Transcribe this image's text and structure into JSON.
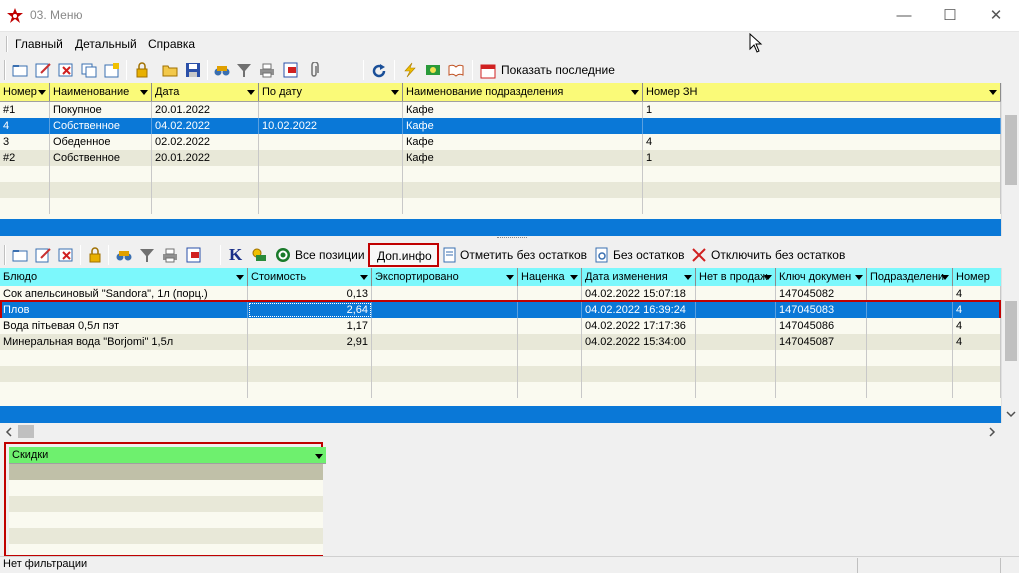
{
  "window": {
    "title": "03. Меню",
    "minimize_glyph": "—",
    "maximize_glyph": "☐",
    "close_glyph": "✕"
  },
  "menu": [
    "Главный",
    "Детальный",
    "Справка"
  ],
  "top_toolbar": {
    "show_last_label": "Показать последние"
  },
  "top_grid": {
    "columns": [
      "Номер",
      "Наименование",
      "Дата",
      "По дату",
      "Наименование подразделения",
      "Номер ЗН"
    ],
    "rows": [
      [
        "#1",
        "Покупное",
        "20.01.2022",
        "",
        "Кафе",
        "1"
      ],
      [
        "4",
        "Собственное",
        "04.02.2022",
        "10.02.2022",
        "Кафе",
        ""
      ],
      [
        "3",
        "Обеденное",
        "02.02.2022",
        "",
        "Кафе",
        "4"
      ],
      [
        "#2",
        "Собственное",
        "20.01.2022",
        "",
        "Кафе",
        "1"
      ]
    ],
    "selected_row": 1
  },
  "bottom_toolbar": {
    "all_positions": "Все позиции",
    "extra_info": "Доп.инфо",
    "mark_no_stock": "Отметить без остатков",
    "no_stock": "Без остатков",
    "disable_no_stock": "Отключить без остатков",
    "k_glyph": "K"
  },
  "bottom_grid": {
    "columns": [
      "Блюдо",
      "Стоимость",
      "Экспортировано",
      "Наценка",
      "Дата изменения",
      "Нет в продаж",
      "Ключ докумен",
      "Подразделени",
      "Номер"
    ],
    "rows": [
      [
        "Сок апельсиновый \"Sandora\", 1л (порц.)",
        "0,13",
        "",
        "",
        "04.02.2022 15:07:18",
        "",
        "147045082",
        "",
        "4"
      ],
      [
        "Плов",
        "2,64",
        "",
        "",
        "04.02.2022 16:39:24",
        "",
        "147045083",
        "",
        "4"
      ],
      [
        "Вода пітьевая 0,5л пэт",
        "1,17",
        "",
        "",
        "04.02.2022 17:17:36",
        "",
        "147045086",
        "",
        "4"
      ],
      [
        "Минеральная вода \"Borjomi\" 1,5л",
        "2,91",
        "",
        "",
        "04.02.2022 15:34:00",
        "",
        "147045087",
        "",
        "4"
      ]
    ],
    "selected_row": 1
  },
  "discounts": {
    "header": "Скидки"
  },
  "status": {
    "text": "Нет фильтрации"
  },
  "colors": {
    "selection": "#0a78d7",
    "header_yellow": "#fafa78",
    "header_cyan": "#7cf8fc",
    "header_green": "#6ef06e",
    "highlight_red": "#c00000"
  }
}
